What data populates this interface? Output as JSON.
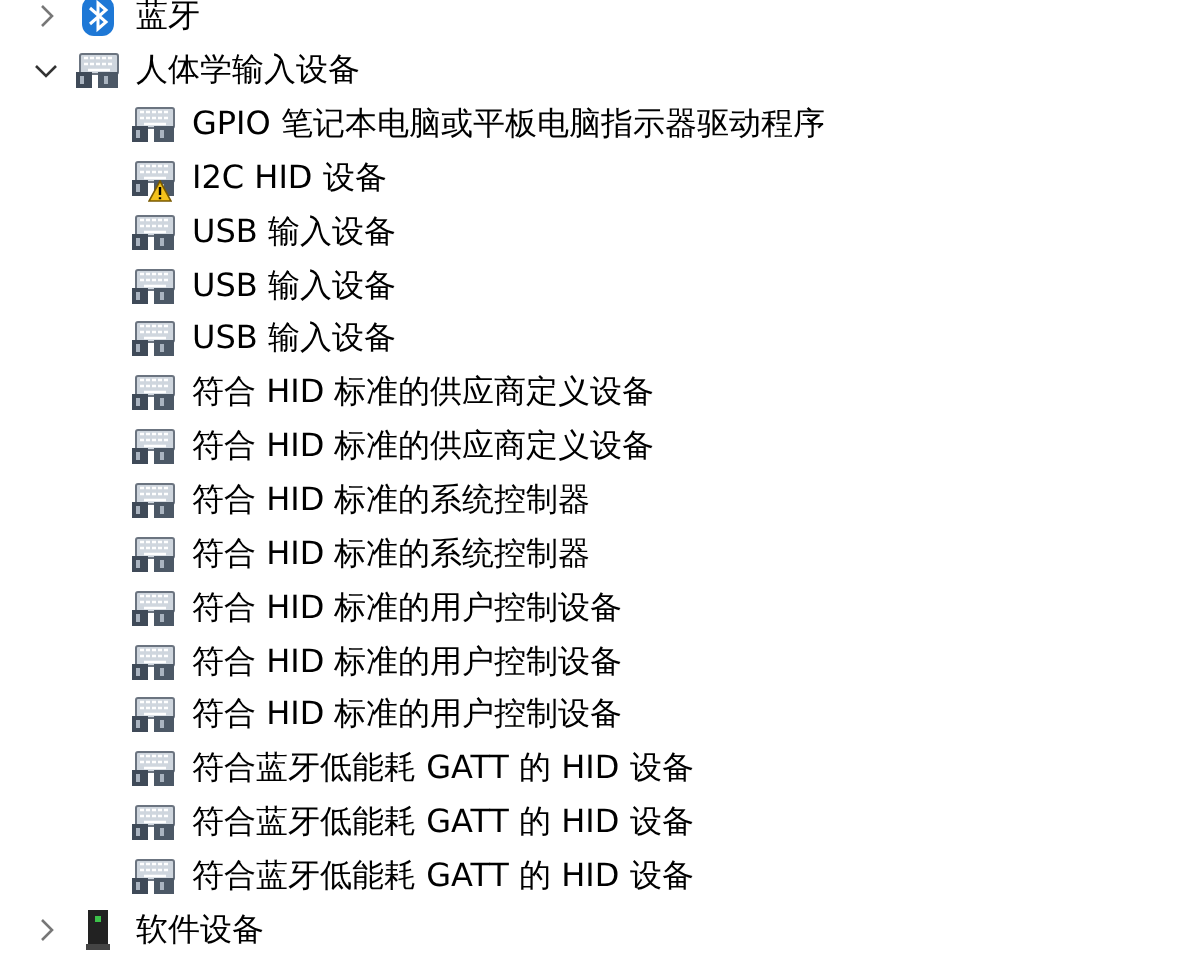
{
  "device_tree": [
    {
      "label": "蓝牙",
      "kind": "bluetooth",
      "expanded": false
    },
    {
      "label": "人体学输入设备",
      "kind": "hid",
      "expanded": true,
      "children": [
        {
          "label": "GPIO 笔记本电脑或平板电脑指示器驱动程序",
          "warning": false
        },
        {
          "label": "I2C HID 设备",
          "warning": true
        },
        {
          "label": "USB 输入设备",
          "warning": false
        },
        {
          "label": "USB 输入设备",
          "warning": false
        },
        {
          "label": "USB 输入设备",
          "warning": false
        },
        {
          "label": "符合 HID 标准的供应商定义设备",
          "warning": false
        },
        {
          "label": "符合 HID 标准的供应商定义设备",
          "warning": false
        },
        {
          "label": "符合 HID 标准的系统控制器",
          "warning": false
        },
        {
          "label": "符合 HID 标准的系统控制器",
          "warning": false
        },
        {
          "label": "符合 HID 标准的用户控制设备",
          "warning": false
        },
        {
          "label": "符合 HID 标准的用户控制设备",
          "warning": false
        },
        {
          "label": "符合 HID 标准的用户控制设备",
          "warning": false
        },
        {
          "label": "符合蓝牙低能耗 GATT 的 HID 设备",
          "warning": false
        },
        {
          "label": "符合蓝牙低能耗 GATT 的 HID 设备",
          "warning": false
        },
        {
          "label": "符合蓝牙低能耗 GATT 的 HID 设备",
          "warning": false
        }
      ]
    },
    {
      "label": "软件设备",
      "kind": "software",
      "expanded": false
    }
  ]
}
